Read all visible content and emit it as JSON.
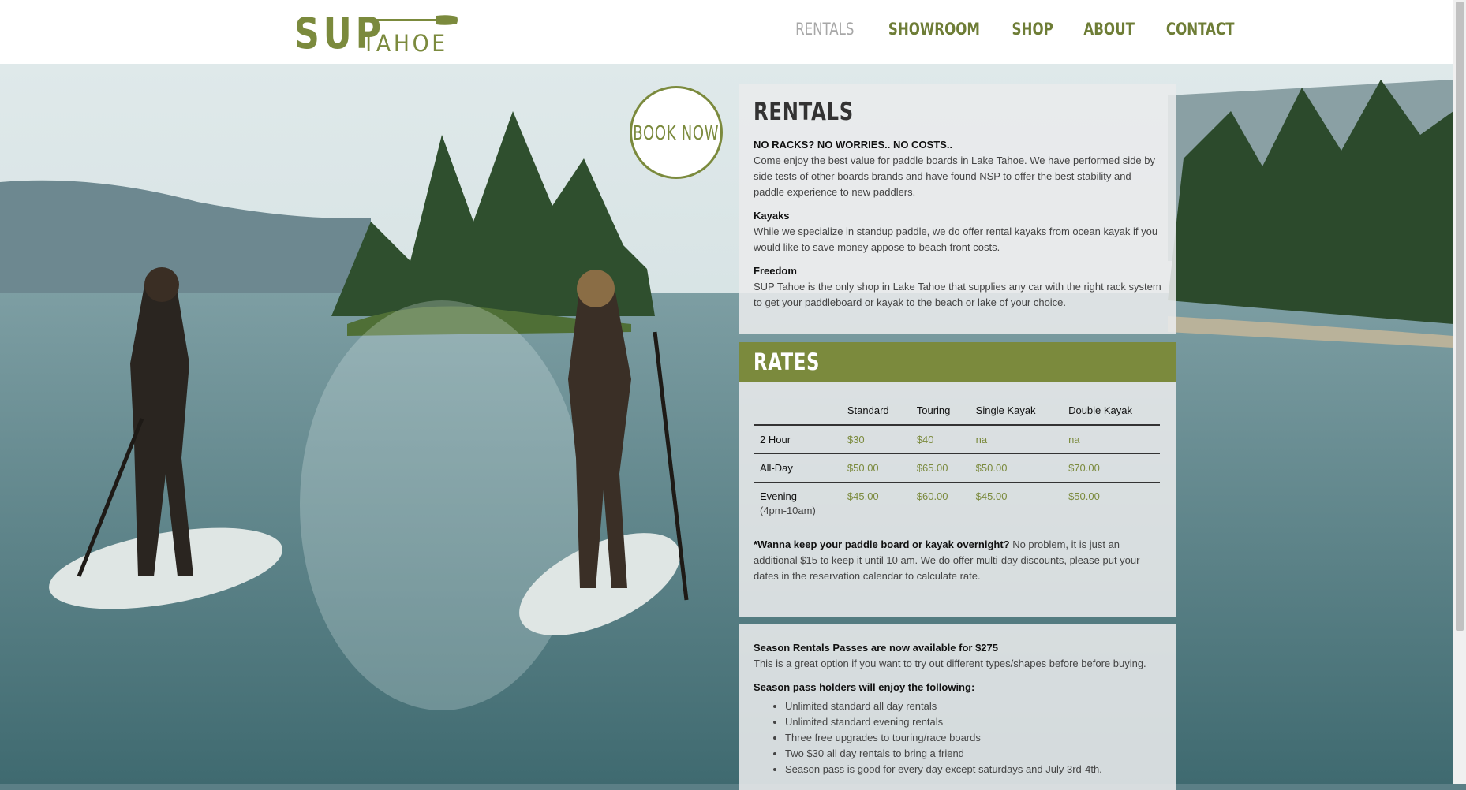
{
  "brand": {
    "logo_sup": "SUP",
    "logo_tahoe": "TAHOE"
  },
  "nav": [
    {
      "label": "RENTALS",
      "active": true
    },
    {
      "label": "SHOWROOM",
      "active": false
    },
    {
      "label": "SHOP",
      "active": false
    },
    {
      "label": "ABOUT",
      "active": false
    },
    {
      "label": "CONTACT",
      "active": false
    }
  ],
  "book_now": "BOOK NOW",
  "rentals": {
    "title": "RENTALS",
    "intro_heading": "NO RACKS? NO WORRIES.. NO COSTS..",
    "intro_text": "Come enjoy the best value for paddle boards in Lake Tahoe. We have performed side by side tests of other boards brands and have found NSP to offer the best stability and paddle experience to new paddlers.",
    "kayaks_heading": "Kayaks",
    "kayaks_text": "While we specialize in standup paddle, we do offer rental kayaks from ocean kayak if you would like to save money appose to beach front costs.",
    "freedom_heading": "Freedom",
    "freedom_text": "SUP Tahoe is the only shop in Lake Tahoe that supplies any car with the right rack system to get your paddleboard or kayak to the beach or lake of your choice."
  },
  "rates": {
    "title": "RATES",
    "columns": [
      "",
      "Standard",
      "Touring",
      "Single Kayak",
      "Double Kayak"
    ],
    "rows": [
      {
        "label": "2 Hour",
        "sub": "",
        "values": [
          "$30",
          "$40",
          "na",
          "na"
        ]
      },
      {
        "label": "All-Day",
        "sub": "",
        "values": [
          "$50.00",
          "$65.00",
          "$50.00",
          "$70.00"
        ]
      },
      {
        "label": "Evening",
        "sub": "(4pm-10am)",
        "values": [
          "$45.00",
          "$60.00",
          "$45.00",
          "$50.00"
        ]
      }
    ],
    "note_bold": "*Wanna keep your paddle board or kayak overnight?",
    "note_text": " No problem, it is just an additional $15 to keep it until 10 am. We do offer multi-day discounts, please put your dates in the reservation calendar to calculate rate."
  },
  "season": {
    "heading": "Season Rentals Passes are now available for $275",
    "text": "This is a great option if you want to try out different types/shapes before before buying.",
    "perks_heading": "Season pass holders will enjoy the following:",
    "perks": [
      "Unlimited standard all day rentals",
      "Unlimited standard evening rentals",
      "Three free upgrades to touring/race boards",
      "Two $30 all day rentals to bring a friend",
      "Season pass is good for every day except saturdays and July 3rd-4th."
    ]
  },
  "colors": {
    "brand_green": "#7b8a3d",
    "nav_inactive": "#6e7d36",
    "nav_active": "#a7a7a7"
  }
}
